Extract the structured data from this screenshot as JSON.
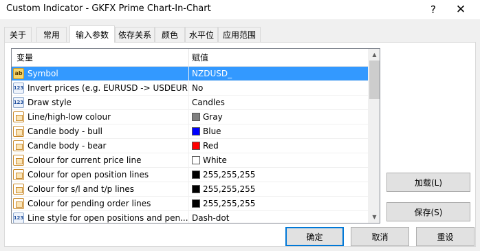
{
  "window": {
    "title": "Custom Indicator - GKFX Prime Chart-In-Chart",
    "help_glyph": "?",
    "close_glyph": "✕"
  },
  "tabs": [
    {
      "label": "关于",
      "active": false
    },
    {
      "label": "常用",
      "active": false
    },
    {
      "label": "输入参数",
      "active": true
    },
    {
      "label": "依存关系",
      "active": false
    },
    {
      "label": "颜色",
      "active": false
    },
    {
      "label": "水平位",
      "active": false
    },
    {
      "label": "应用范围",
      "active": false
    }
  ],
  "grid": {
    "col_variable": "变量",
    "col_value": "赋值",
    "rows": [
      {
        "icon": "ab",
        "name": "Symbol",
        "value": "NZDUSD_",
        "selected": true
      },
      {
        "icon": "123",
        "name": "Invert prices (e.g. EURUSD -> USDEUR)",
        "value": "No"
      },
      {
        "icon": "123",
        "name": "Draw style",
        "value": "Candles"
      },
      {
        "icon": "color",
        "name": "Line/high-low colour",
        "value": "Gray",
        "swatch": "#808080"
      },
      {
        "icon": "color",
        "name": "Candle body - bull",
        "value": "Blue",
        "swatch": "#0000ff"
      },
      {
        "icon": "color",
        "name": "Candle body - bear",
        "value": "Red",
        "swatch": "#ff0000"
      },
      {
        "icon": "color",
        "name": "Colour for current price line",
        "value": "White",
        "swatch": "#ffffff"
      },
      {
        "icon": "color",
        "name": "Colour for open position lines",
        "value": "255,255,255",
        "swatch": "#000000"
      },
      {
        "icon": "color",
        "name": "Colour for s/l and t/p lines",
        "value": "255,255,255",
        "swatch": "#000000"
      },
      {
        "icon": "color",
        "name": "Colour for pending order lines",
        "value": "255,255,255",
        "swatch": "#000000"
      },
      {
        "icon": "123",
        "name": "Line style for open positions and pen...",
        "value": "Dash-dot"
      }
    ]
  },
  "icons": {
    "ab": "ab",
    "123": "123"
  },
  "buttons": {
    "load": "加载(L)",
    "save": "保存(S)",
    "ok": "确定",
    "cancel": "取消",
    "reset": "重设"
  },
  "colors": {
    "selection": "#3399ff",
    "default_button_border": "#0078d7"
  }
}
